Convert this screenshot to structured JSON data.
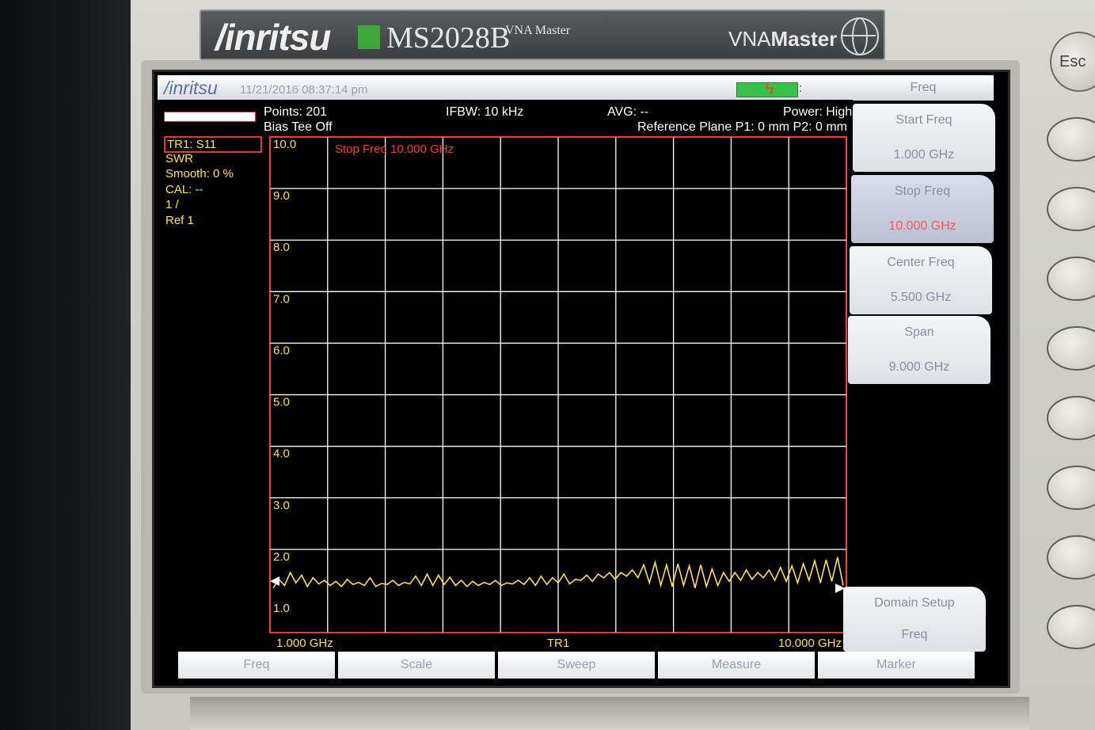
{
  "instrument": {
    "brand": "/inritsu",
    "model": "MS2028B",
    "model_sub": "VNA Master",
    "product_prefix": "VNA",
    "product_suffix": "Master",
    "esc_label": "Esc"
  },
  "topbar": {
    "logo": "/inritsu",
    "datetime": "11/21/2016 08:37:14 pm",
    "colon": ":"
  },
  "status": {
    "points": "Points: 201",
    "bias_tee": "Bias Tee Off",
    "ifbw": "IFBW: 10 kHz",
    "avg": "AVG: --",
    "power": "Power: High",
    "ref_plane": "Reference Plane P1: 0 mm P2: 0 mm"
  },
  "trace_info": {
    "trace": "TR1: S11",
    "format": "SWR",
    "smooth": "Smooth: 0 %",
    "cal": "CAL: --",
    "scale": "1 /",
    "ref": "Ref 1"
  },
  "graph": {
    "annotation": "Stop Freq 10.000 GHz",
    "y_ticks": [
      "10.0",
      "9.0",
      "8.0",
      "7.0",
      "6.0",
      "5.0",
      "4.0",
      "3.0",
      "2.0",
      "1.0"
    ],
    "x_start": "1.000 GHz",
    "x_center_label": "TR1",
    "x_stop": "10.000 GHz",
    "trace_color": "#ffe047",
    "grid_color": "#ffffff",
    "frame_color": "#ff3b30"
  },
  "chart_data": {
    "type": "line",
    "title": "",
    "xlabel": "",
    "ylabel": "",
    "xlim": [
      1.0,
      10.0
    ],
    "ylim": [
      1.0,
      10.0
    ],
    "series": [
      {
        "x": [
          1.0,
          1.09,
          1.18,
          1.27,
          1.36,
          1.45,
          1.54,
          1.63,
          1.72,
          1.81,
          1.9,
          1.99,
          2.08,
          2.17,
          2.26,
          2.35,
          2.44,
          2.53,
          2.62,
          2.71,
          2.8,
          2.89,
          2.98,
          3.07,
          3.16,
          3.25,
          3.34,
          3.43,
          3.52,
          3.61,
          3.7,
          3.79,
          3.88,
          3.97,
          4.06,
          4.15,
          4.24,
          4.33,
          4.42,
          4.51,
          4.6,
          4.69,
          4.78,
          4.87,
          4.96,
          5.05,
          5.14,
          5.23,
          5.32,
          5.41,
          5.5,
          5.59,
          5.68,
          5.77,
          5.86,
          5.95,
          6.04,
          6.13,
          6.22,
          6.31,
          6.4,
          6.49,
          6.58,
          6.67,
          6.76,
          6.85,
          6.94,
          7.03,
          7.12,
          7.21,
          7.3,
          7.39,
          7.48,
          7.57,
          7.66,
          7.75,
          7.84,
          7.93,
          8.02,
          8.11,
          8.2,
          8.29,
          8.38,
          8.47,
          8.56,
          8.65,
          8.74,
          8.83,
          8.92,
          9.01,
          9.1,
          9.19,
          9.28,
          9.37,
          9.46,
          9.55,
          9.64,
          9.73,
          9.82,
          9.91,
          10.0
        ],
        "values": [
          1.25,
          1.42,
          1.3,
          1.55,
          1.35,
          1.5,
          1.28,
          1.45,
          1.33,
          1.4,
          1.3,
          1.38,
          1.28,
          1.42,
          1.32,
          1.36,
          1.3,
          1.45,
          1.28,
          1.34,
          1.32,
          1.4,
          1.3,
          1.36,
          1.33,
          1.48,
          1.3,
          1.52,
          1.3,
          1.5,
          1.32,
          1.46,
          1.3,
          1.4,
          1.28,
          1.38,
          1.3,
          1.36,
          1.32,
          1.4,
          1.3,
          1.35,
          1.33,
          1.4,
          1.32,
          1.45,
          1.3,
          1.48,
          1.32,
          1.45,
          1.35,
          1.52,
          1.33,
          1.42,
          1.4,
          1.5,
          1.38,
          1.52,
          1.45,
          1.55,
          1.42,
          1.55,
          1.48,
          1.6,
          1.45,
          1.7,
          1.35,
          1.75,
          1.3,
          1.7,
          1.28,
          1.72,
          1.3,
          1.68,
          1.25,
          1.7,
          1.28,
          1.62,
          1.3,
          1.55,
          1.38,
          1.55,
          1.4,
          1.6,
          1.42,
          1.55,
          1.45,
          1.6,
          1.4,
          1.65,
          1.38,
          1.68,
          1.35,
          1.72,
          1.4,
          1.78,
          1.35,
          1.8,
          1.38,
          1.85,
          1.3
        ]
      }
    ]
  },
  "softkeys": {
    "title": "Freq",
    "items": [
      {
        "label": "Start Freq",
        "value": "1.000 GHz"
      },
      {
        "label": "Stop Freq",
        "value": "10.000 GHz"
      },
      {
        "label": "Center Freq",
        "value": "5.500 GHz"
      },
      {
        "label": "Span",
        "value": "9.000 GHz"
      },
      {
        "label": "Domain Setup",
        "value": "Freq"
      }
    ]
  },
  "menubar": [
    "Freq",
    "Scale",
    "Sweep",
    "Measure",
    "Marker"
  ]
}
